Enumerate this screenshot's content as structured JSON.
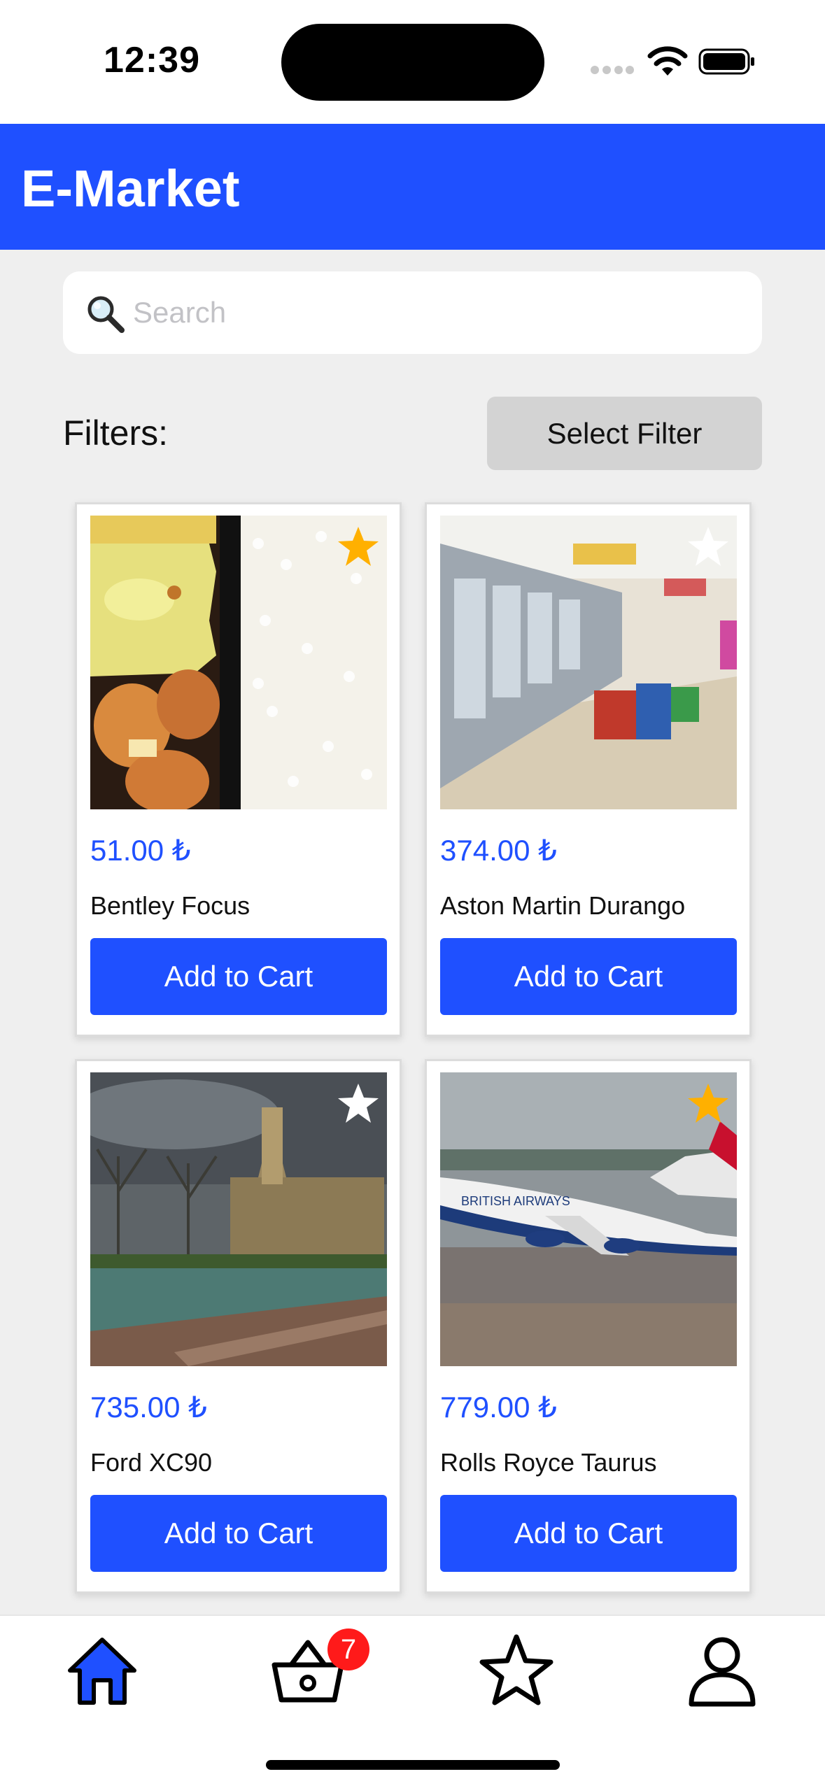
{
  "status_bar": {
    "time": "12:39"
  },
  "header": {
    "title": "E-Market"
  },
  "search": {
    "placeholder": "Search",
    "value": ""
  },
  "filters": {
    "label": "Filters:",
    "button_label": "Select Filter"
  },
  "products": [
    {
      "price": "51.00 ₺",
      "name": "Bentley Focus",
      "button_label": "Add to Cart",
      "favorite": true,
      "image": "bento-food-icon"
    },
    {
      "price": "374.00 ₺",
      "name": "Aston Martin Durango",
      "button_label": "Add to Cart",
      "favorite": false,
      "image": "supermarket-aisle-icon"
    },
    {
      "price": "735.00 ₺",
      "name": "Ford XC90",
      "button_label": "Add to Cart",
      "favorite": false,
      "image": "cathedral-fountain-icon"
    },
    {
      "price": "779.00 ₺",
      "name": "Rolls Royce Taurus",
      "button_label": "Add to Cart",
      "favorite": true,
      "image": "airplane-icon"
    }
  ],
  "tab_bar": {
    "tabs": [
      "home-icon",
      "basket-icon",
      "star-icon",
      "profile-icon"
    ],
    "cart_badge": "7"
  },
  "colors": {
    "accent": "#1f50ff",
    "favorite_on": "#ffb000",
    "badge": "#ff1a1a"
  }
}
